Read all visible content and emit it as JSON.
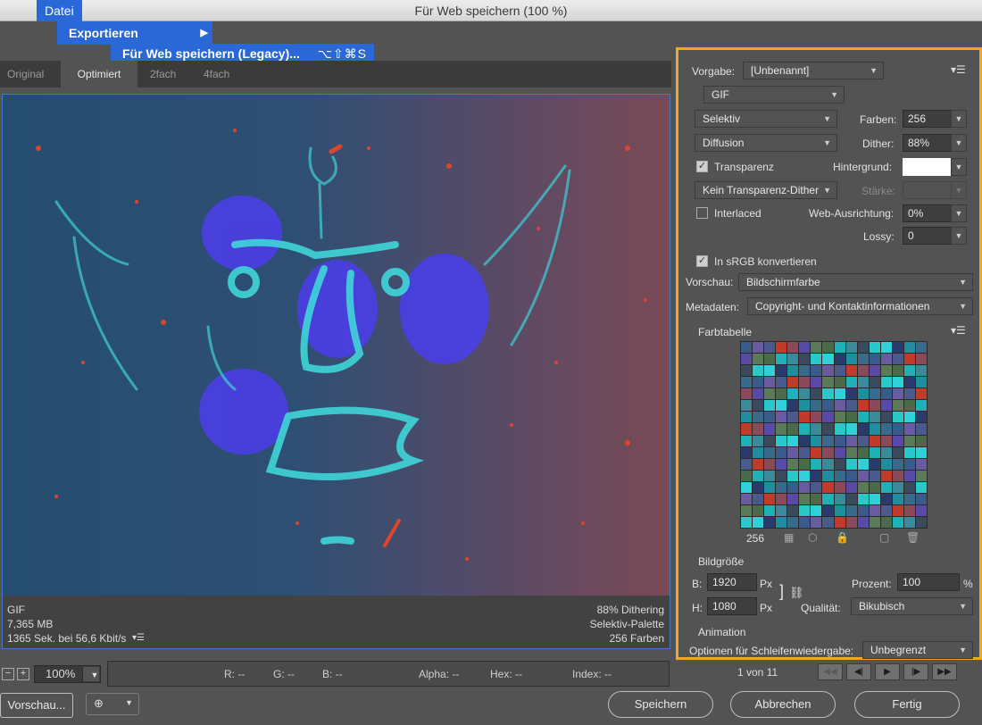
{
  "window": {
    "title": "Für Web speichern (100 %)"
  },
  "menu": {
    "datei": "Datei",
    "exportieren": "Exportieren",
    "submenu_item": "Für Web speichern (Legacy)...",
    "submenu_shortcut": "⌥⇧⌘S"
  },
  "tabs": [
    "Original",
    "Optimiert",
    "2fach",
    "4fach"
  ],
  "active_tab": "Optimiert",
  "preview_info": {
    "format": "GIF",
    "size": "7,365 MB",
    "time": "1365 Sek. bei 56,6 Kbit/s",
    "dithering": "88% Dithering",
    "palette": "Selektiv-Palette",
    "colors": "256 Farben"
  },
  "zoom": {
    "value": "100%"
  },
  "readouts": {
    "r": "R: --",
    "g": "G: --",
    "b": "B: --",
    "alpha": "Alpha: --",
    "hex": "Hex: --",
    "index": "Index: --"
  },
  "frames": {
    "counter": "1 von 11"
  },
  "buttons": {
    "preview": "Vorschau...",
    "save": "Speichern",
    "cancel": "Abbrechen",
    "done": "Fertig"
  },
  "settings": {
    "vorgabe_label": "Vorgabe:",
    "vorgabe_value": "[Unbenannt]",
    "format": "GIF",
    "reduction": "Selektiv",
    "farben_label": "Farben:",
    "farben_value": "256",
    "dither_algo": "Diffusion",
    "dither_label": "Dither:",
    "dither_value": "88%",
    "transparenz_label": "Transparenz",
    "transparenz_checked": true,
    "hintergrund_label": "Hintergrund:",
    "hintergrund_color": "#ffffff",
    "transp_dither": "Kein Transparenz-Dither",
    "staerke_label": "Stärke:",
    "interlaced_label": "Interlaced",
    "interlaced_checked": false,
    "web_label": "Web-Ausrichtung:",
    "web_value": "0%",
    "lossy_label": "Lossy:",
    "lossy_value": "0",
    "srgb_label": "In sRGB konvertieren",
    "srgb_checked": true,
    "vorschau_label": "Vorschau:",
    "vorschau_value": "Bildschirmfarbe",
    "metadaten_label": "Metadaten:",
    "metadaten_value": "Copyright- und Kontaktinformationen",
    "farbtabelle_label": "Farbtabelle",
    "palette_count": "256",
    "bildgroesse_label": "Bildgröße",
    "b_label": "B:",
    "b_value": "1920",
    "h_label": "H:",
    "h_value": "1080",
    "px": "Px",
    "prozent_label": "Prozent:",
    "prozent_value": "100",
    "percent_sign": "%",
    "qualitaet_label": "Qualität:",
    "qualitaet_value": "Bikubisch",
    "animation_label": "Animation",
    "schleife_label": "Optionen für Schleifenwiedergabe:",
    "schleife_value": "Unbegrenzt"
  },
  "colors": {
    "accent_blue": "#2a68d8",
    "highlight_orange": "#f5a623",
    "preview_border": "#3f7ad0"
  },
  "palette_colors": [
    "#3a5a8a",
    "#4a6a4a",
    "#1f8fa0",
    "#5a4aa8",
    "#2fd0d8",
    "#c23a2a",
    "#3a4a5a",
    "#6a5aa0",
    "#1fb0b8",
    "#3a6a8a",
    "#5a7a5a",
    "#2a3a6a",
    "#8a4a5a",
    "#2ac8c8",
    "#4a5a8a",
    "#3a8a9a"
  ]
}
